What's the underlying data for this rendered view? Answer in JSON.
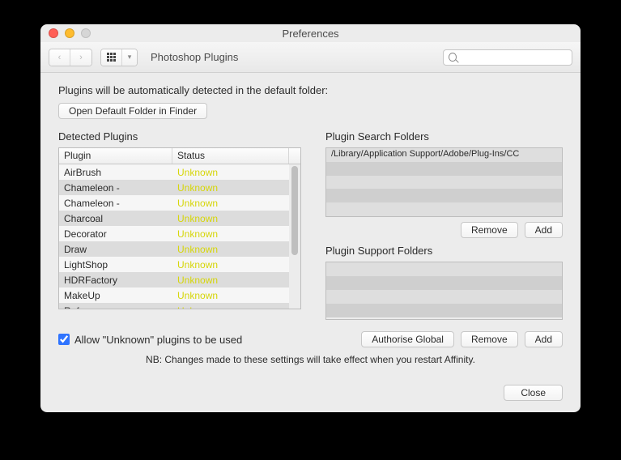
{
  "window": {
    "title": "Preferences"
  },
  "toolbar": {
    "section": "Photoshop Plugins"
  },
  "search": {
    "placeholder": ""
  },
  "intro": "Plugins will be automatically detected in the default folder:",
  "open_default_btn": "Open Default Folder in Finder",
  "detected": {
    "title": "Detected Plugins",
    "columns": {
      "plugin": "Plugin",
      "status": "Status"
    },
    "rows": [
      {
        "name": "AirBrush",
        "status": "Unknown"
      },
      {
        "name": "Chameleon -",
        "status": "Unknown"
      },
      {
        "name": "Chameleon -",
        "status": "Unknown"
      },
      {
        "name": "Charcoal",
        "status": "Unknown"
      },
      {
        "name": "Decorator",
        "status": "Unknown"
      },
      {
        "name": "Draw",
        "status": "Unknown"
      },
      {
        "name": "LightShop",
        "status": "Unknown"
      },
      {
        "name": "HDRFactory",
        "status": "Unknown"
      },
      {
        "name": "MakeUp",
        "status": "Unknown"
      },
      {
        "name": "Refocus",
        "status": "Unknown"
      }
    ]
  },
  "search_folders": {
    "title": "Plugin Search Folders",
    "items": [
      "/Library/Application Support/Adobe/Plug-Ins/CC"
    ],
    "remove": "Remove",
    "add": "Add"
  },
  "support_folders": {
    "title": "Plugin Support Folders",
    "items": [],
    "authorise": "Authorise Global",
    "remove": "Remove",
    "add": "Add"
  },
  "allow_unknown": {
    "label": "Allow \"Unknown\" plugins to be used",
    "checked": true
  },
  "note": "NB: Changes made to these settings will take effect when you restart Affinity.",
  "close": "Close"
}
